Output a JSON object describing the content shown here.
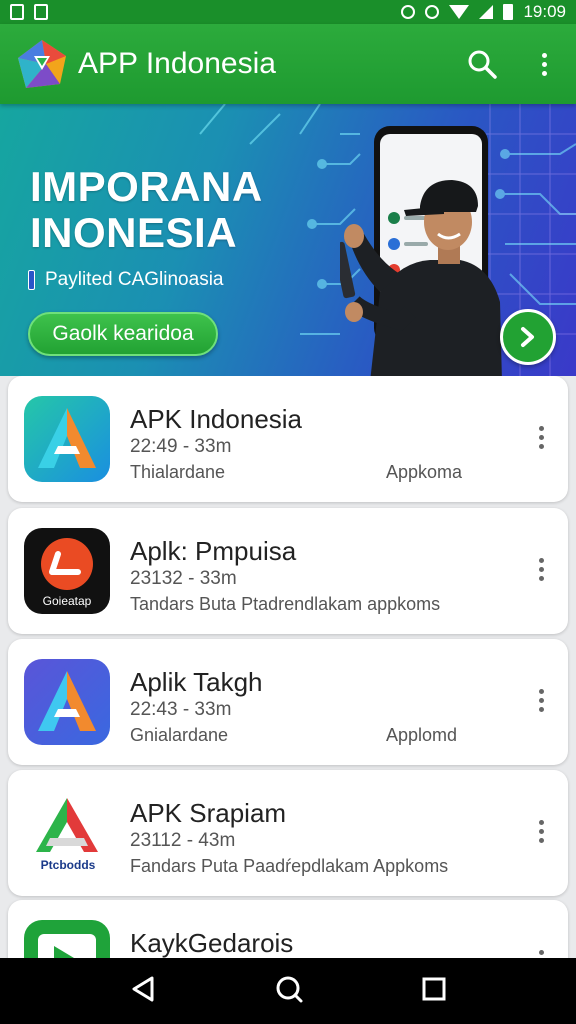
{
  "status_bar": {
    "time": "19:09"
  },
  "app_bar": {
    "title": "APP Indonesia",
    "search_icon": "search-icon",
    "menu_icon": "more-vert-icon"
  },
  "banner": {
    "title_line1": "IMPORANA",
    "title_line2": "INONESIA",
    "subtitle": "Paylited CAGlinoasia",
    "cta_label": "Gaolk kearidoa",
    "next_icon": "chevron-right-icon"
  },
  "apps": [
    {
      "name": "APK Indonesia",
      "meta": "22:49 - 33m",
      "desc": "Thialardane",
      "tag": "Appkoma"
    },
    {
      "name": "Aplk: Pmpuisa",
      "meta": "23132 - 33m",
      "desc": "Tandars Buta Ptadrendlakam appkoms",
      "tag": "",
      "icon_label": "Goieatap"
    },
    {
      "name": "Aplik Takgh",
      "meta": "22:43 - 33m",
      "desc": "Gnialardane",
      "tag": "Applomd"
    },
    {
      "name": "APK Srapiam",
      "meta": "23112 - 43m",
      "desc": "Fandars Puta Paadŕepdlakam Appkoms",
      "tag": "",
      "icon_label": "Ptcbodds"
    },
    {
      "name": "KaykGedarois",
      "meta": "",
      "desc": "",
      "tag": ""
    }
  ],
  "nav": {
    "back": "back-triangle-icon",
    "home": "home-circle-icon",
    "recents": "recents-square-icon"
  },
  "colors": {
    "primary": "#1e9a30",
    "accent": "#22a233",
    "banner_start": "#16a6a0",
    "banner_end": "#3a39c9"
  }
}
